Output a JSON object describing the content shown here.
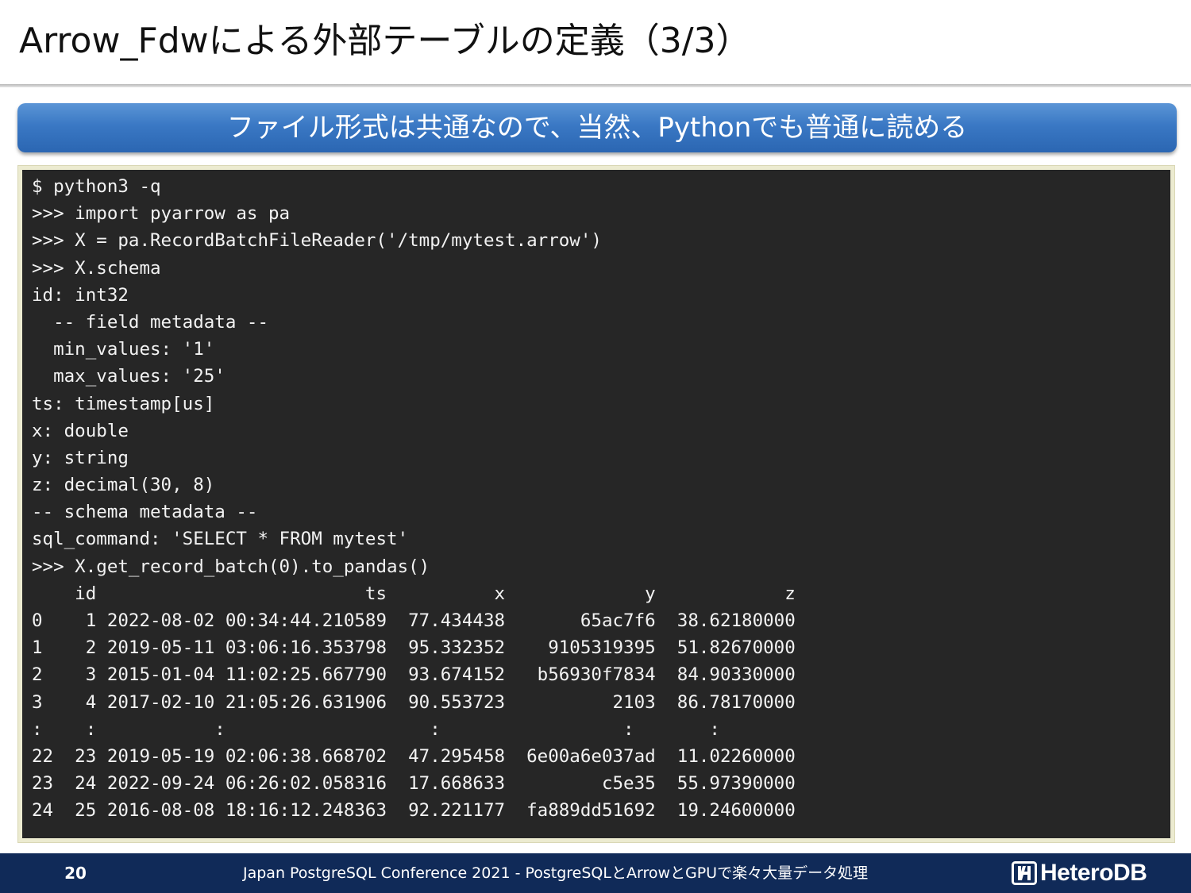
{
  "slide": {
    "title": "Arrow_Fdwによる外部テーブルの定義（3/3）",
    "subtitle": "ファイル形式は共通なので、当然、Pythonでも普通に読める"
  },
  "terminal": {
    "lines": [
      "$ python3 -q",
      ">>> import pyarrow as pa",
      ">>> X = pa.RecordBatchFileReader('/tmp/mytest.arrow')",
      ">>> X.schema",
      "id: int32",
      "  -- field metadata --",
      "  min_values: '1'",
      "  max_values: '25'",
      "ts: timestamp[us]",
      "x: double",
      "y: string",
      "z: decimal(30, 8)",
      "-- schema metadata --",
      "sql_command: 'SELECT * FROM mytest'",
      ">>> X.get_record_batch(0).to_pandas()",
      "    id                         ts          x             y            z",
      "0    1 2022-08-02 00:34:44.210589  77.434438       65ac7f6  38.62180000",
      "1    2 2019-05-11 03:06:16.353798  95.332352    9105319395  51.82670000",
      "2    3 2015-01-04 11:02:25.667790  93.674152   b56930f7834  84.90330000",
      "3    4 2017-02-10 21:05:26.631906  90.553723          2103  86.78170000",
      ":    :           :                   :                 :       :",
      "22  23 2019-05-19 02:06:38.668702  47.295458  6e00a6e037ad  11.02260000",
      "23  24 2022-09-24 06:26:02.058316  17.668633         c5e35  55.97390000",
      "24  25 2016-08-08 18:16:12.248363  92.221177  fa889dd51692  19.24600000"
    ]
  },
  "footer": {
    "page_number": "20",
    "text": "Japan PostgreSQL Conference 2021 - PostgreSQLとArrowとGPUで楽々大量データ処理",
    "logo_text": "HeteroDB"
  },
  "colors": {
    "banner": "#3a78c4",
    "terminal_bg": "#262626",
    "footer_bg": "#102a58"
  }
}
